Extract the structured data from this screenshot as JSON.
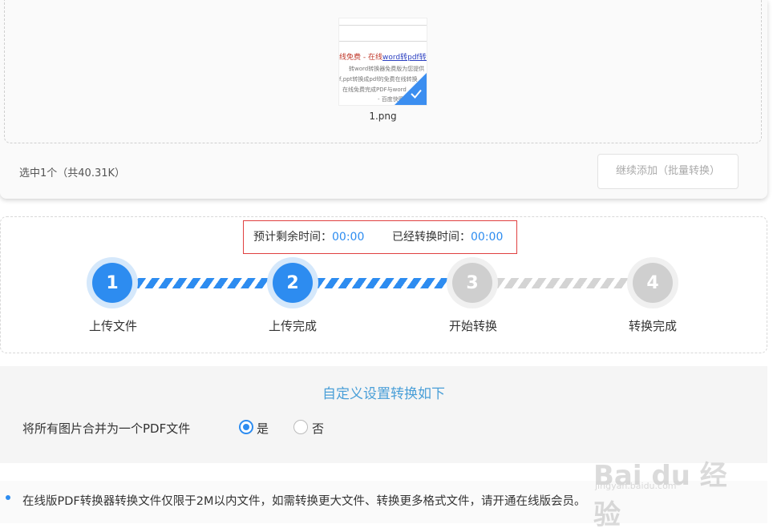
{
  "upload": {
    "file_name": "1.png",
    "thumb_red_text_prefix": "线免费 - 在线",
    "thumb_red_text_link": "word转pdf转换",
    "thumb_line_1": "转word转换器免费版为您提供",
    "thumb_line_2": "f,ppt转换成pdf的免费在线转换",
    "thumb_line_3": "在线免费完成PDF与word",
    "thumb_line_4": "- 百度快照",
    "summary": "选中1个（共40.31K）",
    "add_button": "继续添加（批量转换）"
  },
  "timer": {
    "remaining_label": "预计剩余时间：",
    "remaining_value": "00:00",
    "elapsed_label": "已经转换时间：",
    "elapsed_value": "00:00"
  },
  "steps": [
    {
      "number": "1",
      "label": "上传文件",
      "state": "done"
    },
    {
      "number": "2",
      "label": "上传完成",
      "state": "done"
    },
    {
      "number": "3",
      "label": "开始转换",
      "state": "pending"
    },
    {
      "number": "4",
      "label": "转换完成",
      "state": "pending"
    }
  ],
  "settings": {
    "title": "自定义设置转换如下",
    "merge_label": "将所有图片合并为一个PDF文件",
    "option_yes": "是",
    "option_no": "否",
    "selected": "是"
  },
  "notice": "在线版PDF转换器转换文件仅限于2M以内文件，如需转换更大文件、转换更多格式文件，请开通在线版会员。",
  "watermark": {
    "brand": "Bai du 经验",
    "url": "jingyan.baidu.com"
  },
  "colors": {
    "accent": "#2d8cf0",
    "highlight_border": "#e04040",
    "title_blue": "#4a9fd8"
  }
}
